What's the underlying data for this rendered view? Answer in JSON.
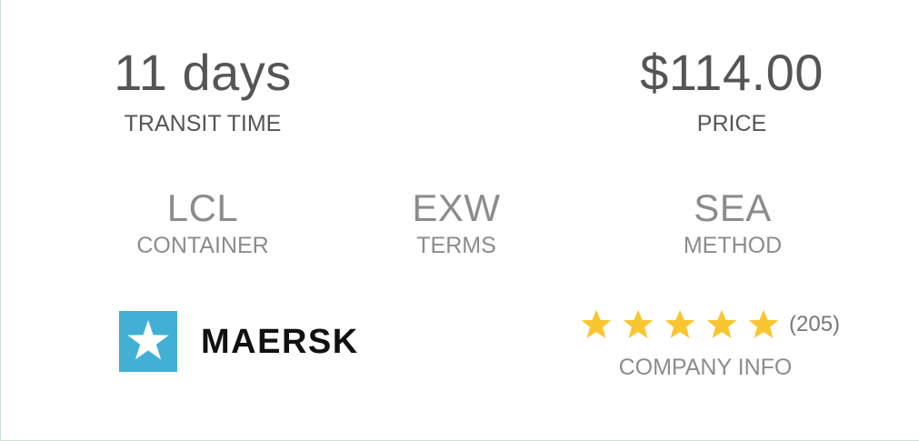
{
  "transit": {
    "value": "11 days",
    "label": "TRANSIT TIME"
  },
  "price": {
    "value": "$114.00",
    "label": "PRICE"
  },
  "container": {
    "value": "LCL",
    "label": "CONTAINER"
  },
  "terms": {
    "value": "EXW",
    "label": "TERMS"
  },
  "method": {
    "value": "SEA",
    "label": "METHOD"
  },
  "carrier": {
    "name": "MAERSK",
    "logo_icon": "maersk-star-icon",
    "logo_color": "#42b0d5"
  },
  "rating": {
    "stars": 5,
    "max_stars": 5,
    "reviews": "(205)",
    "star_color": "#f8c630",
    "star_icon": "star-icon"
  },
  "company_info": {
    "label": "COMPANY INFO"
  }
}
